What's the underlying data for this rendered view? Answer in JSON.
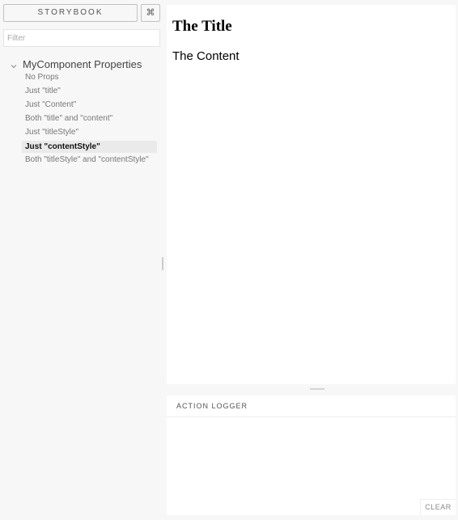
{
  "header": {
    "storybook_label": "STORYBOOK",
    "shortcut_label": "⌘"
  },
  "filter": {
    "placeholder": "Filter",
    "value": ""
  },
  "tree": {
    "kind": "MyComponent Properties",
    "stories": [
      {
        "label": "No Props",
        "selected": false
      },
      {
        "label": "Just \"title\"",
        "selected": false
      },
      {
        "label": "Just \"Content\"",
        "selected": false
      },
      {
        "label": "Both \"title\" and \"content\"",
        "selected": false
      },
      {
        "label": "Just \"titleStyle\"",
        "selected": false
      },
      {
        "label": "Just \"contentStyle\"",
        "selected": true
      },
      {
        "label": "Both \"titleStyle\" and \"contentStyle\"",
        "selected": false
      }
    ]
  },
  "preview": {
    "title": "The Title",
    "content": "The Content"
  },
  "action_logger": {
    "title": "ACTION LOGGER",
    "clear_label": "CLEAR"
  },
  "icons": {
    "chevron": "chevron-down-icon"
  },
  "colors": {
    "background": "#f7f7f7",
    "panel": "#ffffff",
    "selected_bg": "#eaeaea"
  }
}
